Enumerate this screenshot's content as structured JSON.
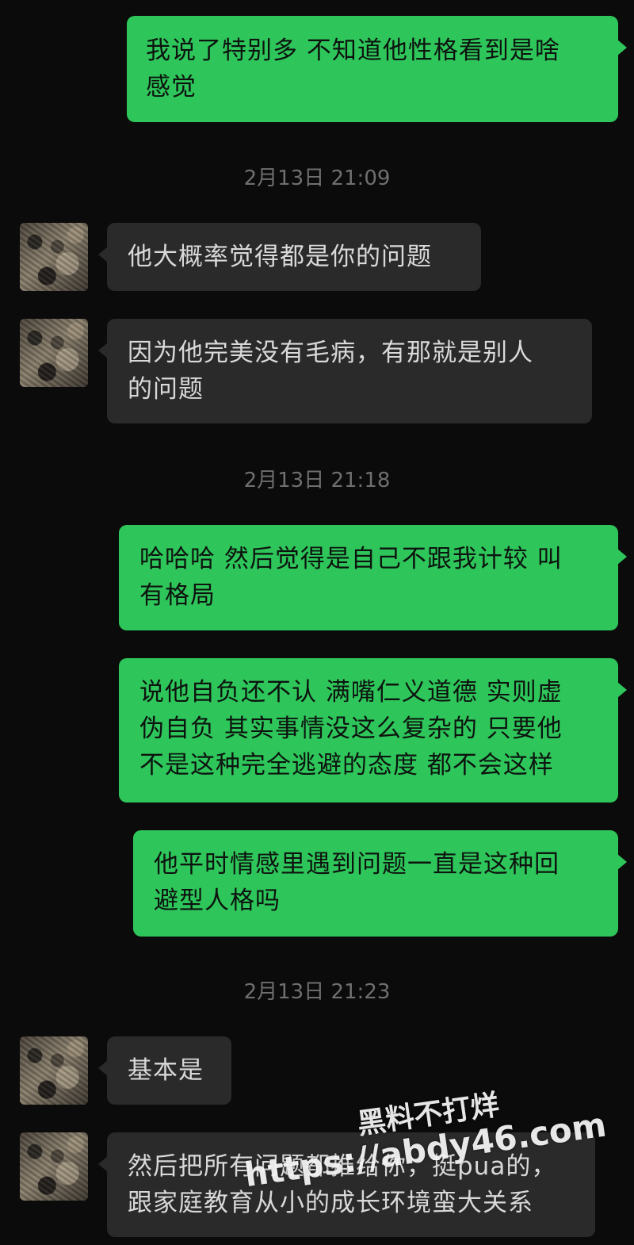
{
  "messages": [
    {
      "side": "sent",
      "text": "我说了特别多 不知道他性格看到是啥\n感觉"
    },
    {
      "type": "time",
      "text": "2月13日 21:09"
    },
    {
      "side": "recv",
      "text": "他大概率觉得都是你的问题"
    },
    {
      "side": "recv",
      "text": "因为他完美没有毛病，有那就是别人\n的问题"
    },
    {
      "type": "time",
      "text": "2月13日 21:18"
    },
    {
      "side": "sent",
      "text": "哈哈哈 然后觉得是自己不跟我计较 叫\n有格局"
    },
    {
      "side": "sent",
      "text": "说他自负还不认 满嘴仁义道德 实则虚\n伪自负 其实事情没这么复杂的 只要他\n不是这种完全逃避的态度 都不会这样"
    },
    {
      "side": "sent",
      "text": "他平时情感里遇到问题一直是这种回\n避型人格吗"
    },
    {
      "type": "time",
      "text": "2月13日 21:23"
    },
    {
      "side": "recv",
      "text": "基本是"
    },
    {
      "side": "recv",
      "text": "然后把所有问题都推给你，挺pua的，\n跟家庭教育从小的成长环境蛮大关系"
    }
  ],
  "watermark": {
    "line1": "黑料不打烊",
    "line2": "https://abdy46.com"
  },
  "colors": {
    "background": "#0b0b0b",
    "sent_bubble": "#2ec65a",
    "received_bubble": "#2a2a2a",
    "timestamp": "#6f6f6f"
  }
}
